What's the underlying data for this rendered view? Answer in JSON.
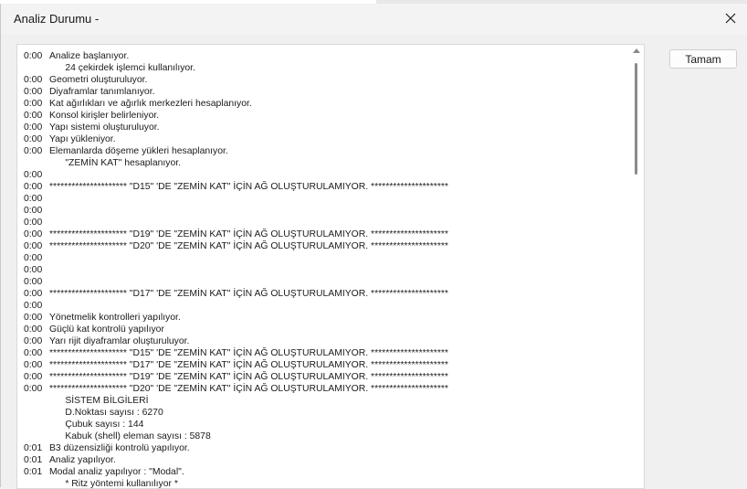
{
  "window": {
    "title": "Analiz Durumu -"
  },
  "buttons": {
    "ok_label": "Tamam"
  },
  "log": [
    {
      "time": "0:00",
      "msg": "Analize başlanıyor."
    },
    {
      "time": "",
      "msg": "      24 çekirdek işlemci kullanılıyor."
    },
    {
      "time": "0:00",
      "msg": "Geometri oluşturuluyor."
    },
    {
      "time": "0:00",
      "msg": "Diyaframlar tanımlanıyor."
    },
    {
      "time": "0:00",
      "msg": "Kat ağırlıkları ve ağırlık merkezleri hesaplanıyor."
    },
    {
      "time": "0:00",
      "msg": "Konsol kirişler belirleniyor."
    },
    {
      "time": "0:00",
      "msg": "Yapı sistemi oluşturuluyor."
    },
    {
      "time": "0:00",
      "msg": "Yapı yükleniyor."
    },
    {
      "time": "0:00",
      "msg": "Elemanlarda döşeme yükleri hesaplanıyor."
    },
    {
      "time": "",
      "msg": "      \"ZEMİN KAT\" hesaplanıyor."
    },
    {
      "time": "0:00",
      "msg": ""
    },
    {
      "time": "0:00",
      "msg": "********************* \"D15\" 'DE \"ZEMİN KAT\" İÇİN AĞ OLUŞTURULAMIYOR. *********************"
    },
    {
      "time": "0:00",
      "msg": ""
    },
    {
      "time": "0:00",
      "msg": ""
    },
    {
      "time": "0:00",
      "msg": ""
    },
    {
      "time": "0:00",
      "msg": "********************* \"D19\" 'DE \"ZEMİN KAT\" İÇİN AĞ OLUŞTURULAMIYOR. *********************"
    },
    {
      "time": "0:00",
      "msg": "********************* \"D20\" 'DE \"ZEMİN KAT\" İÇİN AĞ OLUŞTURULAMIYOR. *********************"
    },
    {
      "time": "0:00",
      "msg": ""
    },
    {
      "time": "0:00",
      "msg": ""
    },
    {
      "time": "0:00",
      "msg": ""
    },
    {
      "time": "0:00",
      "msg": "********************* \"D17\" 'DE \"ZEMİN KAT\" İÇİN AĞ OLUŞTURULAMIYOR. *********************"
    },
    {
      "time": "0:00",
      "msg": ""
    },
    {
      "time": "0:00",
      "msg": "Yönetmelik kontrolleri yapılıyor."
    },
    {
      "time": "0:00",
      "msg": "Güçlü kat kontrolü yapılıyor"
    },
    {
      "time": "0:00",
      "msg": "Yarı rijit diyaframlar oluşturuluyor."
    },
    {
      "time": "0:00",
      "msg": "********************* \"D15\" 'DE \"ZEMİN KAT\" İÇİN AĞ OLUŞTURULAMIYOR. *********************"
    },
    {
      "time": "0:00",
      "msg": "********************* \"D17\" 'DE \"ZEMİN KAT\" İÇİN AĞ OLUŞTURULAMIYOR. *********************"
    },
    {
      "time": "0:00",
      "msg": "********************* \"D19\" 'DE \"ZEMİN KAT\" İÇİN AĞ OLUŞTURULAMIYOR. *********************"
    },
    {
      "time": "0:00",
      "msg": "********************* \"D20\" 'DE \"ZEMİN KAT\" İÇİN AĞ OLUŞTURULAMIYOR. *********************"
    },
    {
      "time": "",
      "msg": "      SİSTEM BİLGİLERİ"
    },
    {
      "time": "",
      "msg": "      D.Noktası sayısı : 6270"
    },
    {
      "time": "",
      "msg": "      Çubuk sayısı : 144"
    },
    {
      "time": "",
      "msg": "      Kabuk (shell) eleman sayısı : 5878"
    },
    {
      "time": "0:01",
      "msg": "B3 düzensizliği kontrolü yapılıyor."
    },
    {
      "time": "0:01",
      "msg": "Analiz yapılıyor."
    },
    {
      "time": "0:01",
      "msg": "Modal analiz yapılıyor : \"Modal\"."
    },
    {
      "time": "",
      "msg": "      * Ritz yöntemi kullanılıyor *"
    }
  ]
}
